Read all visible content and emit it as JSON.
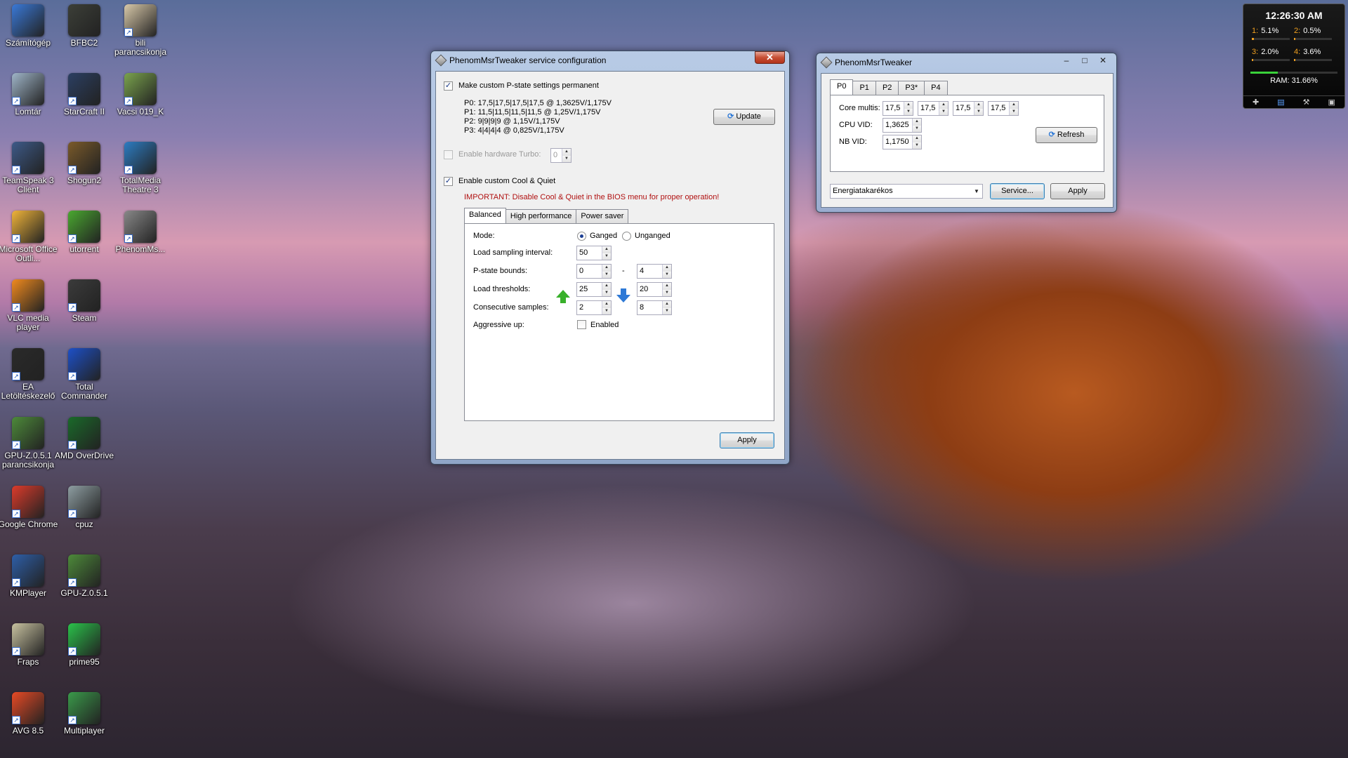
{
  "desktop_icons": [
    {
      "label": "Számítógép",
      "color": "#3a79d8"
    },
    {
      "label": "BFBC2",
      "color": "#3c3f38"
    },
    {
      "label": "bili parancsikonja",
      "color": "#d9c9a9"
    },
    {
      "label": "Lomtár",
      "color": "#9fb5c8"
    },
    {
      "label": "StarCraft II",
      "color": "#2b3f62"
    },
    {
      "label": "Vacsi 019_K",
      "color": "#7aa34d"
    },
    {
      "label": "TeamSpeak 3 Client",
      "color": "#3d5a88"
    },
    {
      "label": "Shogun2",
      "color": "#7a5a2a"
    },
    {
      "label": "TotalMedia Theatre 3",
      "color": "#2d7cc2"
    },
    {
      "label": "Microsoft Office Outli...",
      "color": "#f0b43a"
    },
    {
      "label": "utorrent",
      "color": "#4aa830"
    },
    {
      "label": "PhenomMs...",
      "color": "#888888"
    },
    {
      "label": "VLC media player",
      "color": "#f08a1e"
    },
    {
      "label": "Steam",
      "color": "#3b3b3b"
    },
    {
      "label": "EA Letöltéskezelő",
      "color": "#2a2a2a"
    },
    {
      "label": "Total Commander",
      "color": "#1d50c8"
    },
    {
      "label": "GPU-Z.0.5.1 parancsikonja",
      "color": "#4d8a3a"
    },
    {
      "label": "AMD OverDrive",
      "color": "#1a6a2a"
    },
    {
      "label": "Google Chrome",
      "color": "#dc3b2b"
    },
    {
      "label": "cpuz",
      "color": "#8e9ea2"
    },
    {
      "label": "KMPlayer",
      "color": "#2e5fa8"
    },
    {
      "label": "GPU-Z.0.5.1",
      "color": "#4d8a3a"
    },
    {
      "label": "Fraps",
      "color": "#c8c2a0"
    },
    {
      "label": "prime95",
      "color": "#2ac24a"
    },
    {
      "label": "AVG 8.5",
      "color": "#e84a25"
    },
    {
      "label": "Multiplayer",
      "color": "#3a9a4a"
    }
  ],
  "service_window": {
    "title": "PhenomMsrTweaker service configuration",
    "permanent_label": "Make custom P-state settings permanent",
    "pstates": [
      "P0: 17,5|17,5|17,5|17,5 @ 1,3625V/1,175V",
      "P1: 11,5|11,5|11,5|11,5 @ 1,25V/1,175V",
      "P2: 9|9|9|9 @ 1,15V/1,175V",
      "P3: 4|4|4|4 @ 0,825V/1,175V"
    ],
    "update_label": "Update",
    "hw_turbo_label": "Enable hardware Turbo:",
    "hw_turbo_value": "0",
    "cnq_label": "Enable custom Cool & Quiet",
    "important": "IMPORTANT: Disable Cool & Quiet in the BIOS menu for proper operation!",
    "tabs": [
      "Balanced",
      "High performance",
      "Power saver"
    ],
    "mode_label": "Mode:",
    "ganged": "Ganged",
    "unganged": "Unganged",
    "sampling_label": "Load sampling interval:",
    "sampling_value": "50",
    "bounds_label": "P-state bounds:",
    "bounds_low": "0",
    "bounds_sep": "-",
    "bounds_high": "4",
    "thresholds_label": "Load thresholds:",
    "threshold_up": "25",
    "threshold_down": "20",
    "consec_label": "Consecutive samples:",
    "consec_up": "2",
    "consec_down": "8",
    "aggressive_label": "Aggressive up:",
    "enabled_label": "Enabled",
    "apply_label": "Apply"
  },
  "tweaker_window": {
    "title": "PhenomMsrTweaker",
    "tabs": [
      "P0",
      "P1",
      "P2",
      "P3*",
      "P4"
    ],
    "core_multis_label": "Core multis:",
    "core_multis": [
      "17,5",
      "17,5",
      "17,5",
      "17,5"
    ],
    "cpu_vid_label": "CPU VID:",
    "cpu_vid": "1,3625",
    "nb_vid_label": "NB VID:",
    "nb_vid": "1,1750",
    "refresh_label": "Refresh",
    "power_plan": "Energiatakarékos",
    "service_label": "Service...",
    "apply_label": "Apply"
  },
  "gadget": {
    "time": "12:26:30 AM",
    "cores": [
      {
        "id": "1:",
        "val": "5.1%",
        "load": 0.051
      },
      {
        "id": "2:",
        "val": "0.5%",
        "load": 0.005
      },
      {
        "id": "3:",
        "val": "2.0%",
        "load": 0.02
      },
      {
        "id": "4:",
        "val": "3.6%",
        "load": 0.036
      }
    ],
    "ram": "RAM: 31.66%",
    "ram_load": 0.3166
  }
}
